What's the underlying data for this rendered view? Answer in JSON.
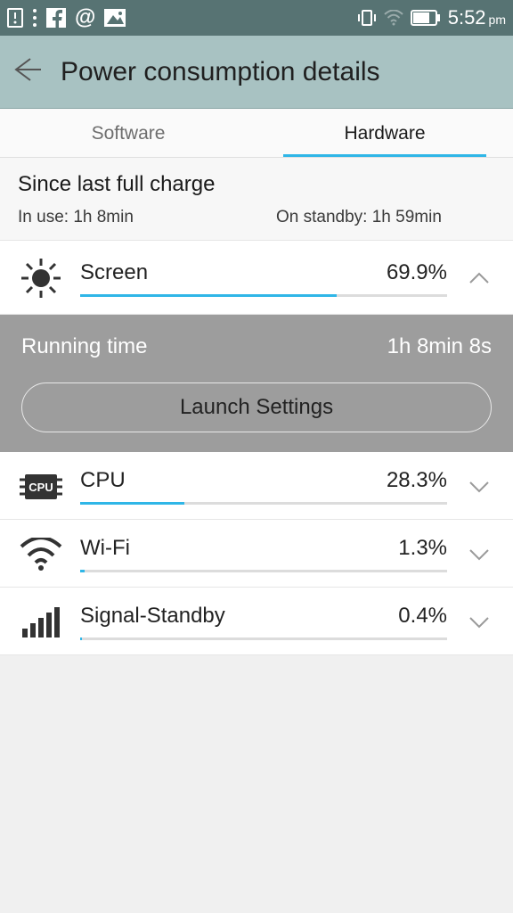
{
  "status": {
    "time": "5:52",
    "ampm": "pm"
  },
  "header": {
    "title": "Power consumption details"
  },
  "tabs": {
    "software": "Software",
    "hardware": "Hardware",
    "active": "hardware"
  },
  "since": {
    "heading": "Since last full charge",
    "in_use_label": "In use: 1h 8min",
    "standby_label": "On standby: 1h 59min"
  },
  "running": {
    "label": "Running time",
    "value": "1h 8min 8s",
    "launch": "Launch Settings"
  },
  "items": [
    {
      "name": "Screen",
      "pct": "69.9%",
      "fill": 69.9
    },
    {
      "name": "CPU",
      "pct": "28.3%",
      "fill": 28.3
    },
    {
      "name": "Wi-Fi",
      "pct": "1.3%",
      "fill": 1.3
    },
    {
      "name": "Signal-Standby",
      "pct": "0.4%",
      "fill": 0.4
    }
  ]
}
